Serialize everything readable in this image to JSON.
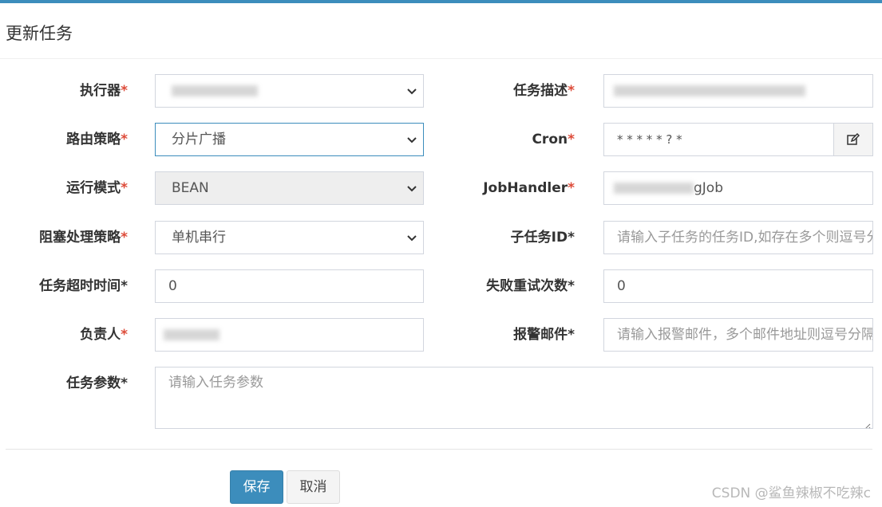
{
  "title": "更新任务",
  "accent_color": "#3c8dbc",
  "required_color": "#dd4b39",
  "fields": {
    "executor": {
      "label": "执行器",
      "value": ""
    },
    "route": {
      "label": "路由策略",
      "value": "分片广播"
    },
    "mode": {
      "label": "运行模式",
      "value": "BEAN"
    },
    "block": {
      "label": "阻塞处理策略",
      "value": "单机串行"
    },
    "timeout": {
      "label": "任务超时时间",
      "value": "0"
    },
    "owner": {
      "label": "负责人",
      "value": ""
    },
    "desc": {
      "label": "任务描述",
      "value": ""
    },
    "cron": {
      "label": "Cron",
      "value": "* * * * * ? *"
    },
    "handler": {
      "label": "JobHandler",
      "value_suffix": "gJob"
    },
    "child": {
      "label": "子任务ID",
      "placeholder": "请输入子任务的任务ID,如存在多个则逗号分隔"
    },
    "retry": {
      "label": "失败重试次数",
      "value": "0"
    },
    "alarm": {
      "label": "报警邮件",
      "placeholder": "请输入报警邮件，多个邮件地址则逗号分隔"
    },
    "param": {
      "label": "任务参数",
      "placeholder": "请输入任务参数"
    }
  },
  "buttons": {
    "save": "保存",
    "cancel": "取消"
  },
  "watermark": "CSDN @鲨鱼辣椒不吃辣c"
}
